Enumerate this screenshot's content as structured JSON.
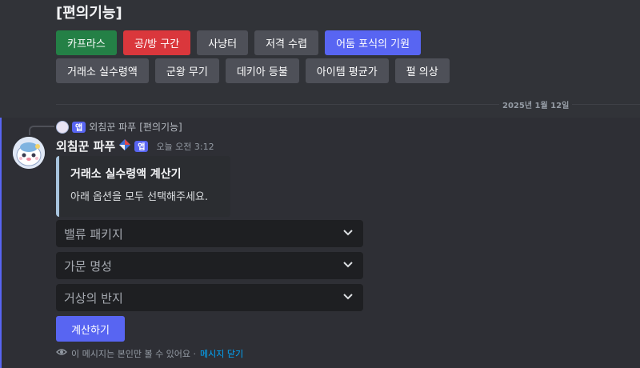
{
  "section_title": "[편의기능]",
  "buttons_row1": [
    {
      "label": "카프라스",
      "color": "#248046"
    },
    {
      "label": "공/방 구간",
      "color": "#da373c"
    },
    {
      "label": "사냥터",
      "color": "#4e5058"
    },
    {
      "label": "저격 수렵",
      "color": "#4e5058"
    },
    {
      "label": "어둠 포식의 기원",
      "color": "#5865f2"
    }
  ],
  "buttons_row2": [
    {
      "label": "거래소 실수령액",
      "color": "#4e5058"
    },
    {
      "label": "군왕 무기",
      "color": "#4e5058"
    },
    {
      "label": "데키아 등불",
      "color": "#4e5058"
    },
    {
      "label": "아이템 평균가",
      "color": "#4e5058"
    },
    {
      "label": "펄 의상",
      "color": "#4e5058"
    }
  ],
  "date_divider": "2025년 1월 12일",
  "reply": {
    "author": "외침꾼 파푸",
    "badge": "앱",
    "text": "[편의기능]"
  },
  "message": {
    "author": "외침꾼 파푸",
    "badge": "앱",
    "timestamp": "오늘 오전 3:12",
    "avatar_icon": "papu-avatar-icon",
    "author_decoration_icon": "diamond-icon"
  },
  "embed": {
    "title": "거래소 실수령액 계산기",
    "description": "아래 옵션을 모두 선택해주세요.",
    "accent_color": "#a8c4de"
  },
  "selects": [
    {
      "placeholder": "밸류 패키지"
    },
    {
      "placeholder": "가문 명성"
    },
    {
      "placeholder": "거상의 반지"
    }
  ],
  "submit_label": "계산하기",
  "ephemeral": {
    "text": "이 메시지는 본인만 볼 수 있어요 ·",
    "dismiss": "메시지 닫기"
  },
  "colors": {
    "background": "#313338",
    "accent": "#5865f2",
    "link": "#00a8fc"
  }
}
